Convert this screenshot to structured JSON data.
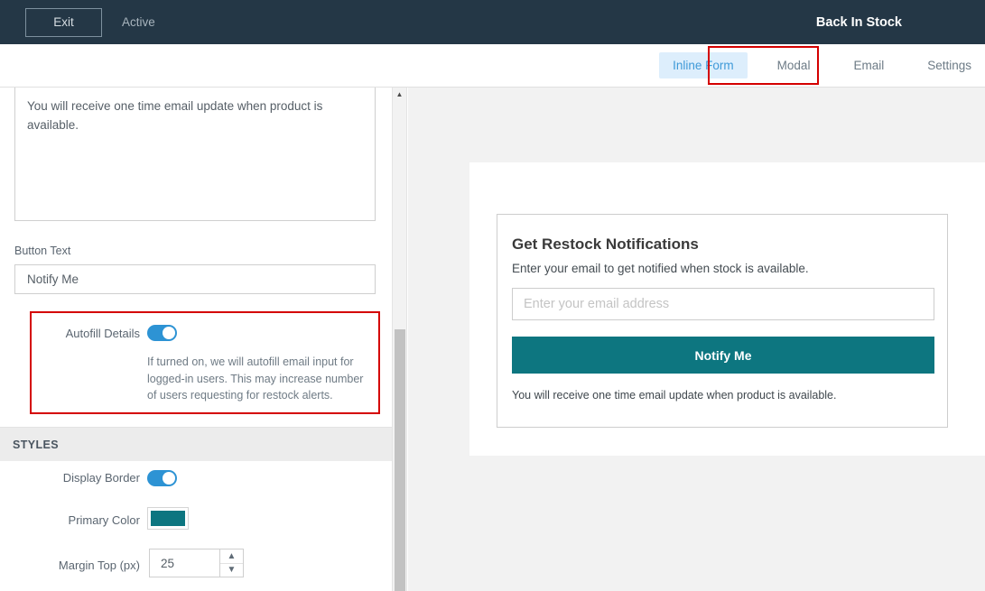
{
  "navbar": {
    "exit_label": "Exit",
    "status_label": "Active",
    "title": "Back In Stock",
    "bg_color": "#243746"
  },
  "tabs": [
    {
      "label": "Inline Form",
      "selected": true
    },
    {
      "label": "Modal",
      "selected": false
    },
    {
      "label": "Email",
      "selected": false
    },
    {
      "label": "Settings",
      "selected": false
    }
  ],
  "settings_panel": {
    "description_textarea_value": "You will receive one time email update when product is available.",
    "button_text_label": "Button Text",
    "button_text_value": "Notify Me",
    "autofill": {
      "label": "Autofill Details",
      "enabled": true,
      "help_text": "If turned on, we will autofill email input for logged-in users. This may increase number of users requesting for restock alerts."
    },
    "styles_section": {
      "header": "STYLES",
      "display_border_label": "Display Border",
      "display_border_enabled": true,
      "primary_color_label": "Primary Color",
      "primary_color_value": "#0d7680",
      "margin_top_label": "Margin Top (px)",
      "margin_top_value": "25",
      "stepper_up_icon": "chevron-up-icon",
      "stepper_down_icon": "chevron-down-icon"
    },
    "scrollbar_up_icon": "triangle-up-icon"
  },
  "preview": {
    "card_title": "Get Restock Notifications",
    "card_subtitle": "Enter your email to get notified when stock is available.",
    "email_placeholder": "Enter your email address",
    "submit_label": "Notify Me",
    "footnote": "You will receive one time email update when product is available.",
    "accent_color": "#0d7680"
  },
  "annotations": {
    "highlight_color": "#d40000",
    "tab_highlight_target": "Inline Form",
    "autofill_highlight_target": "Autofill Details"
  }
}
